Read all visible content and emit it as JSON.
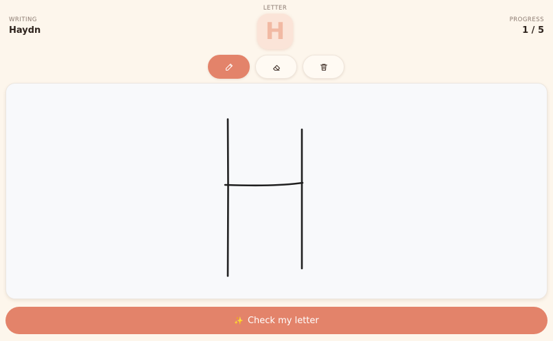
{
  "header": {
    "writing_label": "WRITING",
    "writing_name": "Haydn",
    "letter_label": "LETTER",
    "letter": "H",
    "progress_label": "PROGRESS",
    "progress_value": "1 / 5"
  },
  "tools": [
    {
      "name": "pencil-icon",
      "active": true
    },
    {
      "name": "eraser-icon",
      "active": false
    },
    {
      "name": "trash-icon",
      "active": false
    }
  ],
  "canvas": {
    "stroke_color": "#1f1f1f"
  },
  "actions": {
    "check_label": "Check my letter",
    "check_icon": "sparkles-icon"
  },
  "colors": {
    "accent": "#e3836a",
    "background": "#fdf6ec",
    "tile": "#fbe4d8"
  }
}
